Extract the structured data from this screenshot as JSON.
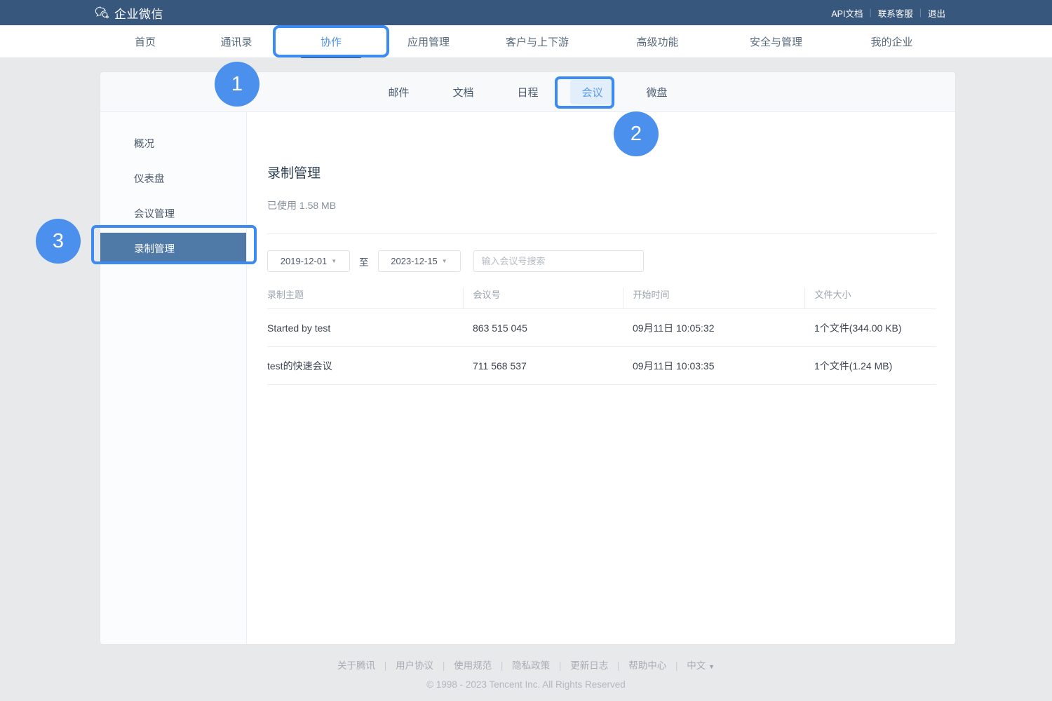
{
  "topbar": {
    "brand": "企业微信",
    "brand_icon": "wecom-chat-logo-icon",
    "links": [
      "API文档",
      "联系客服",
      "退出"
    ],
    "separator": "|"
  },
  "mainnav": {
    "items": [
      {
        "label": "首页",
        "active": false
      },
      {
        "label": "通讯录",
        "active": false
      },
      {
        "label": "协作",
        "active": true
      },
      {
        "label": "应用管理",
        "active": false
      },
      {
        "label": "客户与上下游",
        "active": false
      },
      {
        "label": "高级功能",
        "active": false
      },
      {
        "label": "安全与管理",
        "active": false
      },
      {
        "label": "我的企业",
        "active": false
      }
    ]
  },
  "subtabs": {
    "items": [
      {
        "label": "邮件",
        "active": false
      },
      {
        "label": "文档",
        "active": false
      },
      {
        "label": "日程",
        "active": false
      },
      {
        "label": "会议",
        "active": true
      },
      {
        "label": "微盘",
        "active": false
      }
    ]
  },
  "sidebar": {
    "items": [
      {
        "label": "概况",
        "active": false
      },
      {
        "label": "仪表盘",
        "active": false
      },
      {
        "label": "会议管理",
        "active": false
      },
      {
        "label": "录制管理",
        "active": true
      }
    ]
  },
  "content": {
    "title": "录制管理",
    "usage": "已使用 1.58 MB",
    "filters": {
      "date_from": "2019-12-01",
      "date_to": "2023-12-15",
      "between_label": "至",
      "caret_icon": "chevron-down-icon",
      "search_placeholder": "输入会议号搜索",
      "search_value": ""
    },
    "table": {
      "headers": [
        "录制主题",
        "会议号",
        "开始时间",
        "文件大小"
      ],
      "rows": [
        {
          "topic": "Started by test",
          "meeting_id": "863 515 045",
          "start_time": "09月11日 10:05:32",
          "file_size": "1个文件(344.00 KB)"
        },
        {
          "topic": "test的快速会议",
          "meeting_id": "711 568 537",
          "start_time": "09月11日 10:03:35",
          "file_size": "1个文件(1.24 MB)"
        }
      ]
    }
  },
  "footer": {
    "links": [
      "关于腾讯",
      "用户协议",
      "使用规范",
      "隐私政策",
      "更新日志",
      "帮助中心"
    ],
    "language": "中文",
    "language_caret_icon": "chevron-down-icon",
    "separator": "|",
    "copyright": "© 1998 - 2023 Tencent Inc. All Rights Reserved"
  },
  "annotations": {
    "badges": [
      {
        "label": "1"
      },
      {
        "label": "2"
      },
      {
        "label": "3"
      }
    ],
    "accent_color": "#4a90ec",
    "highlight_color": "#3d8bf2"
  }
}
